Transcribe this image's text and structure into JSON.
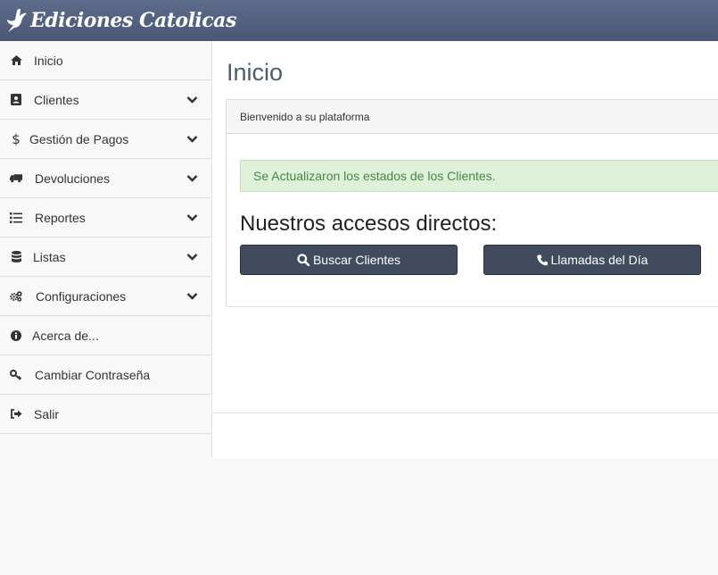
{
  "app": {
    "brand": "Ediciones Catolicas"
  },
  "sidebar": {
    "items": [
      {
        "label": "Inicio",
        "icon": "home-icon",
        "expandable": false
      },
      {
        "label": "Clientes",
        "icon": "address-book-icon",
        "expandable": true
      },
      {
        "label": "Gestión de Pagos",
        "icon": "dollar-icon",
        "expandable": true
      },
      {
        "label": "Devoluciones",
        "icon": "truck-icon",
        "expandable": true
      },
      {
        "label": "Reportes",
        "icon": "list-icon",
        "expandable": true
      },
      {
        "label": "Listas",
        "icon": "database-icon",
        "expandable": true
      },
      {
        "label": "Configuraciones",
        "icon": "gears-icon",
        "expandable": true
      },
      {
        "label": "Acerca de...",
        "icon": "info-circle-icon",
        "expandable": false
      },
      {
        "label": "Cambiar Contraseña",
        "icon": "key-icon",
        "expandable": false
      },
      {
        "label": "Salir",
        "icon": "sign-out-icon",
        "expandable": false
      }
    ]
  },
  "main": {
    "title": "Inicio",
    "panel": {
      "heading": "Bienvenido a su plataforma",
      "alert": "Se Actualizaron los estados de los Clientes.",
      "shortcuts_title": "Nuestros accesos directos:",
      "buttons": [
        {
          "label": "Buscar Clientes",
          "icon": "search-icon"
        },
        {
          "label": "Llamadas del Día",
          "icon": "phone-icon"
        }
      ]
    }
  },
  "colors": {
    "topbar": "#4a5775",
    "button": "#424b5e",
    "alert_bg": "#dff0d8",
    "alert_text": "#468847",
    "title_text": "#4e5d6c"
  }
}
